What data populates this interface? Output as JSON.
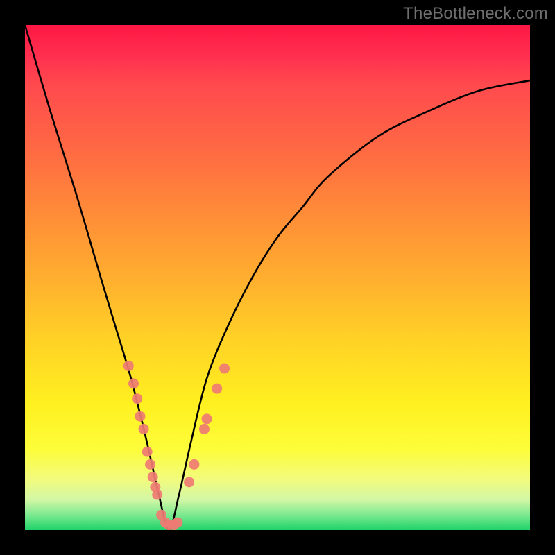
{
  "watermark": "TheBottleneck.com",
  "chart_data": {
    "type": "line",
    "title": "",
    "xlabel": "",
    "ylabel": "",
    "xlim": [
      0,
      1
    ],
    "ylim": [
      0,
      1
    ],
    "note": "No numeric axes or tick labels are present. The plot shows a V-shaped bottleneck curve against a vertical red→green gradient (red high, green low). The curve minimum sits near x≈0.28, y≈0.",
    "series": [
      {
        "name": "bottleneck-curve",
        "x": [
          0.0,
          0.05,
          0.1,
          0.15,
          0.18,
          0.21,
          0.24,
          0.265,
          0.285,
          0.305,
          0.33,
          0.36,
          0.4,
          0.45,
          0.5,
          0.55,
          0.6,
          0.7,
          0.8,
          0.9,
          1.0
        ],
        "y": [
          1.0,
          0.83,
          0.67,
          0.5,
          0.4,
          0.3,
          0.18,
          0.07,
          0.0,
          0.07,
          0.18,
          0.3,
          0.4,
          0.5,
          0.58,
          0.64,
          0.7,
          0.78,
          0.83,
          0.87,
          0.89
        ]
      }
    ],
    "markers": {
      "name": "highlighted-points",
      "color": "#ef7b73",
      "points": [
        {
          "x": 0.205,
          "y": 0.325
        },
        {
          "x": 0.215,
          "y": 0.29
        },
        {
          "x": 0.222,
          "y": 0.26
        },
        {
          "x": 0.228,
          "y": 0.225
        },
        {
          "x": 0.235,
          "y": 0.2
        },
        {
          "x": 0.242,
          "y": 0.155
        },
        {
          "x": 0.248,
          "y": 0.13
        },
        {
          "x": 0.253,
          "y": 0.105
        },
        {
          "x": 0.258,
          "y": 0.085
        },
        {
          "x": 0.262,
          "y": 0.07
        },
        {
          "x": 0.27,
          "y": 0.03
        },
        {
          "x": 0.278,
          "y": 0.015
        },
        {
          "x": 0.285,
          "y": 0.01
        },
        {
          "x": 0.295,
          "y": 0.01
        },
        {
          "x": 0.302,
          "y": 0.015
        },
        {
          "x": 0.325,
          "y": 0.095
        },
        {
          "x": 0.335,
          "y": 0.13
        },
        {
          "x": 0.355,
          "y": 0.2
        },
        {
          "x": 0.36,
          "y": 0.22
        },
        {
          "x": 0.38,
          "y": 0.28
        },
        {
          "x": 0.395,
          "y": 0.32
        }
      ]
    }
  }
}
